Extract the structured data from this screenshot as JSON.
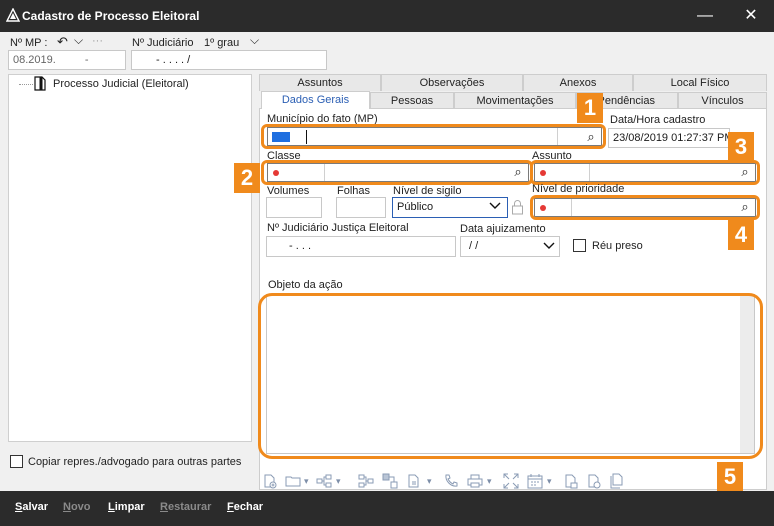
{
  "window": {
    "title": "Cadastro de Processo Eleitoral",
    "minimize_glyph": "—",
    "close_glyph": "✕"
  },
  "header": {
    "mp_label": "Nº MP :",
    "mp_value_year": "08.2019.",
    "mp_value_dash": "-",
    "undo_glyph": "↶",
    "dropdown_glyph": "⌵",
    "more_glyph": "···",
    "judicial_label": "Nº Judiciário",
    "grau_label": "1º grau",
    "grau_dropdown_glyph": "⌵",
    "judicial_value": "- .   . . .   /"
  },
  "tree": {
    "root_label": "Processo Judicial (Eleitoral)"
  },
  "tabs": {
    "row1": [
      "Assuntos",
      "Observações",
      "Anexos",
      "Local Físico"
    ],
    "row2": [
      "Dados Gerais",
      "Pessoas",
      "Movimentações",
      "Pendências",
      "Vínculos"
    ]
  },
  "form": {
    "municipio_label": "Município do fato (MP)",
    "data_hora_label": "Data/Hora cadastro",
    "data_hora_value": "23/08/2019 01:27:37 PM",
    "classe_label": "Classe",
    "assunto_label": "Assunto",
    "volumes_label": "Volumes",
    "folhas_label": "Folhas",
    "sigilo_label": "Nível de sigilo",
    "sigilo_value": "Público",
    "prioridade_label": "Nível de prioridade",
    "nj_eleitoral_label": "Nº Judiciário Justiça Eleitoral",
    "nj_eleitoral_value": "-  .     .   .",
    "data_ajuizamento_label": "Data ajuizamento",
    "data_ajuizamento_value": "/  /",
    "reu_preso_label": "Réu preso",
    "objeto_label": "Objeto da ação",
    "search_glyph": "⌕"
  },
  "copiar_label": "Copiar repres./advogado para outras partes",
  "badges": [
    "1",
    "2",
    "3",
    "4",
    "5"
  ],
  "toolbar_icons": [
    "add-document-icon",
    "folder-icon",
    "hierarchy-icon",
    "network-icon",
    "network-alt-icon",
    "link-document-icon",
    "phone-icon",
    "print-icon",
    "expand-icon",
    "calendar-icon",
    "document-lock-icon",
    "document-settings-icon",
    "document-stack-icon"
  ],
  "bottom": {
    "salvar": "Salvar",
    "novo": "Novo",
    "limpar": "Limpar",
    "restaurar": "Restaurar",
    "fechar": "Fechar"
  },
  "colors": {
    "highlight": "#f08a1c",
    "accent_blue": "#2b5fb4",
    "required_dot": "#e53935",
    "titlebar": "#2b2b2b"
  }
}
